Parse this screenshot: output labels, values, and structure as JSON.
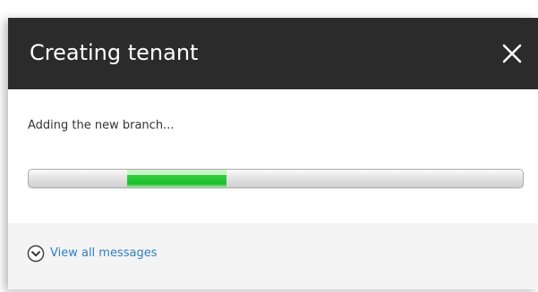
{
  "dialog": {
    "title": "Creating tenant",
    "close_icon": "close-icon"
  },
  "body": {
    "status": "Adding the new branch..."
  },
  "progress": {
    "segment_start": 0.2,
    "segment_end": 0.4,
    "indeterminate": true,
    "fill_color": "#1ebf2e"
  },
  "footer": {
    "view_all_label": "View all messages",
    "icon": "chevron-down-circle-icon",
    "link_color": "#2f7fc1"
  }
}
